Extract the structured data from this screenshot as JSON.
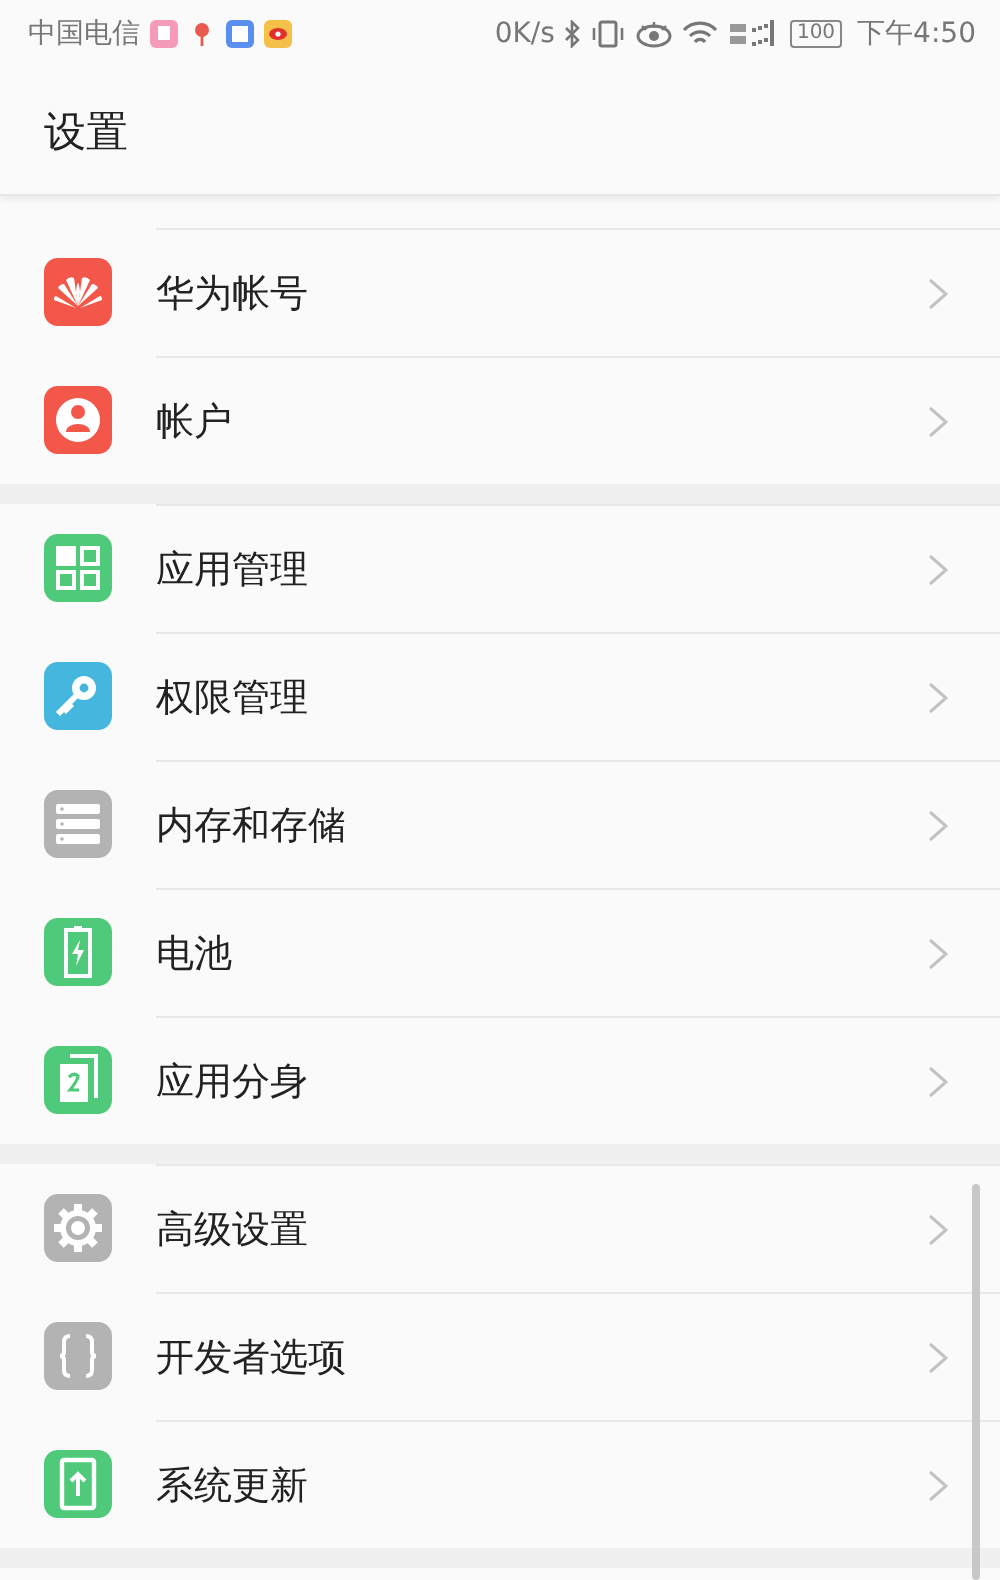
{
  "status_bar": {
    "carrier": "中国电信",
    "speed": "0K/s",
    "battery": "100",
    "time": "下午4:50"
  },
  "title": "设置",
  "groups": [
    {
      "items": [
        {
          "kind": "huawei",
          "label": "华为帐号"
        },
        {
          "kind": "account",
          "label": "帐户"
        }
      ]
    },
    {
      "items": [
        {
          "kind": "apps",
          "label": "应用管理"
        },
        {
          "kind": "key",
          "label": "权限管理"
        },
        {
          "kind": "storage",
          "label": "内存和存储"
        },
        {
          "kind": "battery",
          "label": "电池"
        },
        {
          "kind": "twin",
          "label": "应用分身"
        }
      ]
    },
    {
      "items": [
        {
          "kind": "gear",
          "label": "高级设置"
        },
        {
          "kind": "braces",
          "label": "开发者选项"
        },
        {
          "kind": "update",
          "label": "系统更新"
        }
      ]
    }
  ]
}
